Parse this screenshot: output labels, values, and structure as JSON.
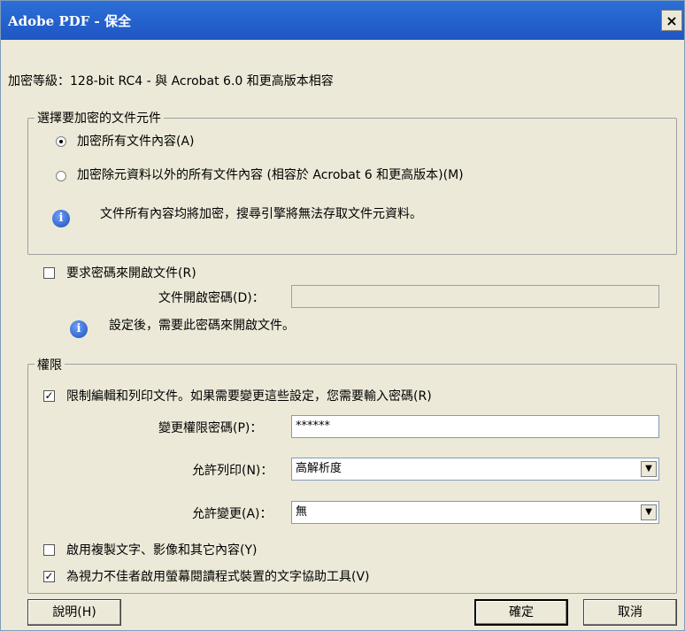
{
  "window": {
    "title": "Adobe PDF - 保全",
    "close_label": "×"
  },
  "encryption_level": "加密等級：128-bit RC4 - 與 Acrobat 6.0 和更高版本相容",
  "encrypt_group": {
    "legend": "選擇要加密的文件元件",
    "option_all": "加密所有文件內容(A)",
    "option_all_checked": true,
    "option_except_meta": "加密除元資料以外的所有文件內容 (相容於 Acrobat 6 和更高版本)(M)",
    "info_text": "文件所有內容均將加密，搜尋引擎將無法存取文件元資料。"
  },
  "open_password": {
    "checkbox_label": "要求密碼來開啟文件(R)",
    "checked": false,
    "field_label": "文件開啟密碼(D)：",
    "value": "",
    "info_text": "設定後，需要此密碼來開啟文件。"
  },
  "permissions": {
    "legend": "權限",
    "restrict_label": "限制編輯和列印文件。如果需要變更這些設定，您需要輸入密碼(R)",
    "restrict_checked": true,
    "change_pw_label": "變更權限密碼(P)：",
    "change_pw_value": "******",
    "printing_label": "允許列印(N)：",
    "printing_value": "高解析度",
    "changes_label": "允許變更(A)：",
    "changes_value": "無",
    "copy_label": "啟用複製文字、影像和其它內容(Y)",
    "copy_checked": false,
    "access_label": "為視力不佳者啟用螢幕閱讀程式裝置的文字協助工具(V)",
    "access_checked": true
  },
  "buttons": {
    "help": "說明(H)",
    "ok": "確定",
    "cancel": "取消"
  },
  "checkmark": "✓",
  "dropdown_arrow": "▼",
  "info_glyph": "i"
}
